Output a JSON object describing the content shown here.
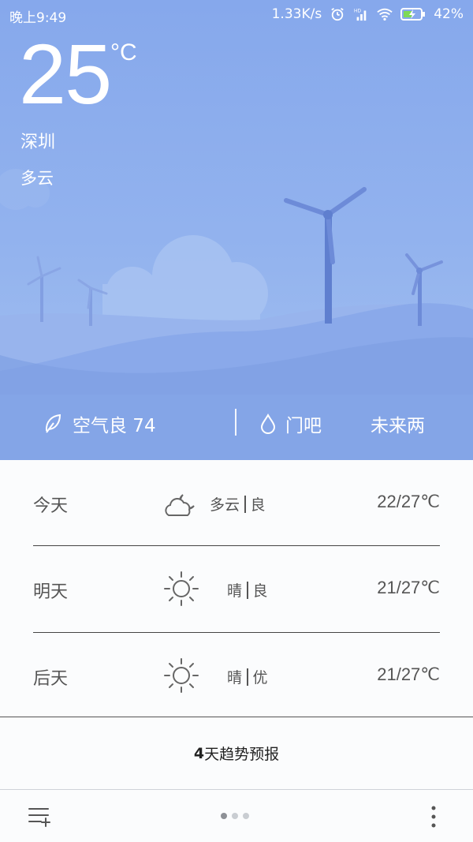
{
  "status_bar": {
    "time": "晚上9:49",
    "net_speed": "1.33K/s",
    "battery": "42%",
    "icons": [
      "alarm-icon",
      "signal-hd-icon",
      "wifi-icon",
      "battery-charging-icon"
    ]
  },
  "current": {
    "temperature": "25",
    "unit": "°C",
    "city": "深圳",
    "condition": "多云"
  },
  "info_strip": {
    "aqi_label": "空气良 74",
    "tip_label": "门吧",
    "future_label": "未来两"
  },
  "forecast": [
    {
      "day": "今天",
      "condition": "多云",
      "quality": "良",
      "range": "22/27℃",
      "icon": "partly-cloudy-night-icon"
    },
    {
      "day": "明天",
      "condition": "晴",
      "quality": "良",
      "range": "21/27℃",
      "icon": "sun-icon"
    },
    {
      "day": "后天",
      "condition": "晴",
      "quality": "优",
      "range": "21/27℃",
      "icon": "sun-icon"
    }
  ],
  "trend_button": {
    "number": "4",
    "label": "天趋势预报"
  },
  "bottom_bar": {
    "page_count": 3,
    "active_page": 1
  },
  "colors": {
    "sky_top": "#86a8ec",
    "sky_bottom": "#a5c2f1",
    "hill": "#7d9de0",
    "text_dark": "#555555"
  }
}
